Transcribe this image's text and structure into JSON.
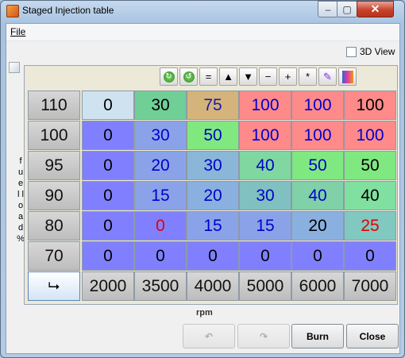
{
  "window": {
    "title": "Staged Injection table",
    "close_glyph": "✕",
    "min_glyph": "–",
    "max_glyph": "▢"
  },
  "menu": {
    "file": "File"
  },
  "view3d_label": "3D View",
  "y_axis_label": "f u e l l o a d %",
  "x_axis_label": "rpm",
  "toolbar_icons": [
    "rotate-cw-icon",
    "rotate-ccw-icon",
    "equals-icon",
    "up-triangle-icon",
    "down-triangle-icon",
    "minus-icon",
    "plus-icon",
    "asterisk-icon",
    "pen-icon",
    "palette-icon"
  ],
  "toolbar_glyphs": [
    "↻",
    "↺",
    "=",
    "▲",
    "▼",
    "−",
    "+",
    "*",
    "✎",
    "▮"
  ],
  "y_values": [
    "110",
    "100",
    "95",
    "90",
    "80",
    "70"
  ],
  "x_values": [
    "2000",
    "3500",
    "4000",
    "5000",
    "6000",
    "7000"
  ],
  "cells": [
    [
      "0",
      "30",
      "75",
      "100",
      "100",
      "100"
    ],
    [
      "0",
      "30",
      "50",
      "100",
      "100",
      "100"
    ],
    [
      "0",
      "20",
      "30",
      "40",
      "50",
      "50"
    ],
    [
      "0",
      "15",
      "20",
      "30",
      "40",
      "40"
    ],
    [
      "0",
      "0",
      "15",
      "15",
      "20",
      "25"
    ],
    [
      "0",
      "0",
      "0",
      "0",
      "0",
      "0"
    ]
  ],
  "cell_bg": [
    [
      "#cfe2f0",
      "#6fcf97",
      "#d4b47a",
      "#ff8a8a",
      "#ff8a8a",
      "#ff8a8a"
    ],
    [
      "#8080ff",
      "#8aa3e8",
      "#80e87f",
      "#ff8a8a",
      "#ff8a8a",
      "#ff8a8a"
    ],
    [
      "#8080ff",
      "#8aa3e8",
      "#8ab6d8",
      "#80d8a0",
      "#80e880",
      "#80e880"
    ],
    [
      "#8080ff",
      "#8aa3e8",
      "#8ab0e0",
      "#80c0c0",
      "#80d0a8",
      "#80e0a0"
    ],
    [
      "#8080ff",
      "#8080ff",
      "#8aa3e8",
      "#8aa3e8",
      "#8ab0e0",
      "#80c8c0"
    ],
    [
      "#8080ff",
      "#8080ff",
      "#8080ff",
      "#8080ff",
      "#8080ff",
      "#8080ff"
    ]
  ],
  "cell_fg": [
    [
      "#000000",
      "#000000",
      "#1a1aa8",
      "#0000cc",
      "#0000cc",
      "#000000"
    ],
    [
      "#000000",
      "#0000cc",
      "#0000cc",
      "#0000cc",
      "#0000cc",
      "#0000cc"
    ],
    [
      "#000000",
      "#0000cc",
      "#0000cc",
      "#0000cc",
      "#0000cc",
      "#000000"
    ],
    [
      "#000000",
      "#0000cc",
      "#0000cc",
      "#0000cc",
      "#0000cc",
      "#000000"
    ],
    [
      "#000000",
      "#e00000",
      "#0000cc",
      "#0000cc",
      "#000000",
      "#e00000"
    ],
    [
      "#000000",
      "#000000",
      "#000000",
      "#000000",
      "#000000",
      "#000000"
    ]
  ],
  "buttons": {
    "undo_icon": "undo-icon",
    "redo_icon": "redo-icon",
    "burn": "Burn",
    "close": "Close"
  }
}
